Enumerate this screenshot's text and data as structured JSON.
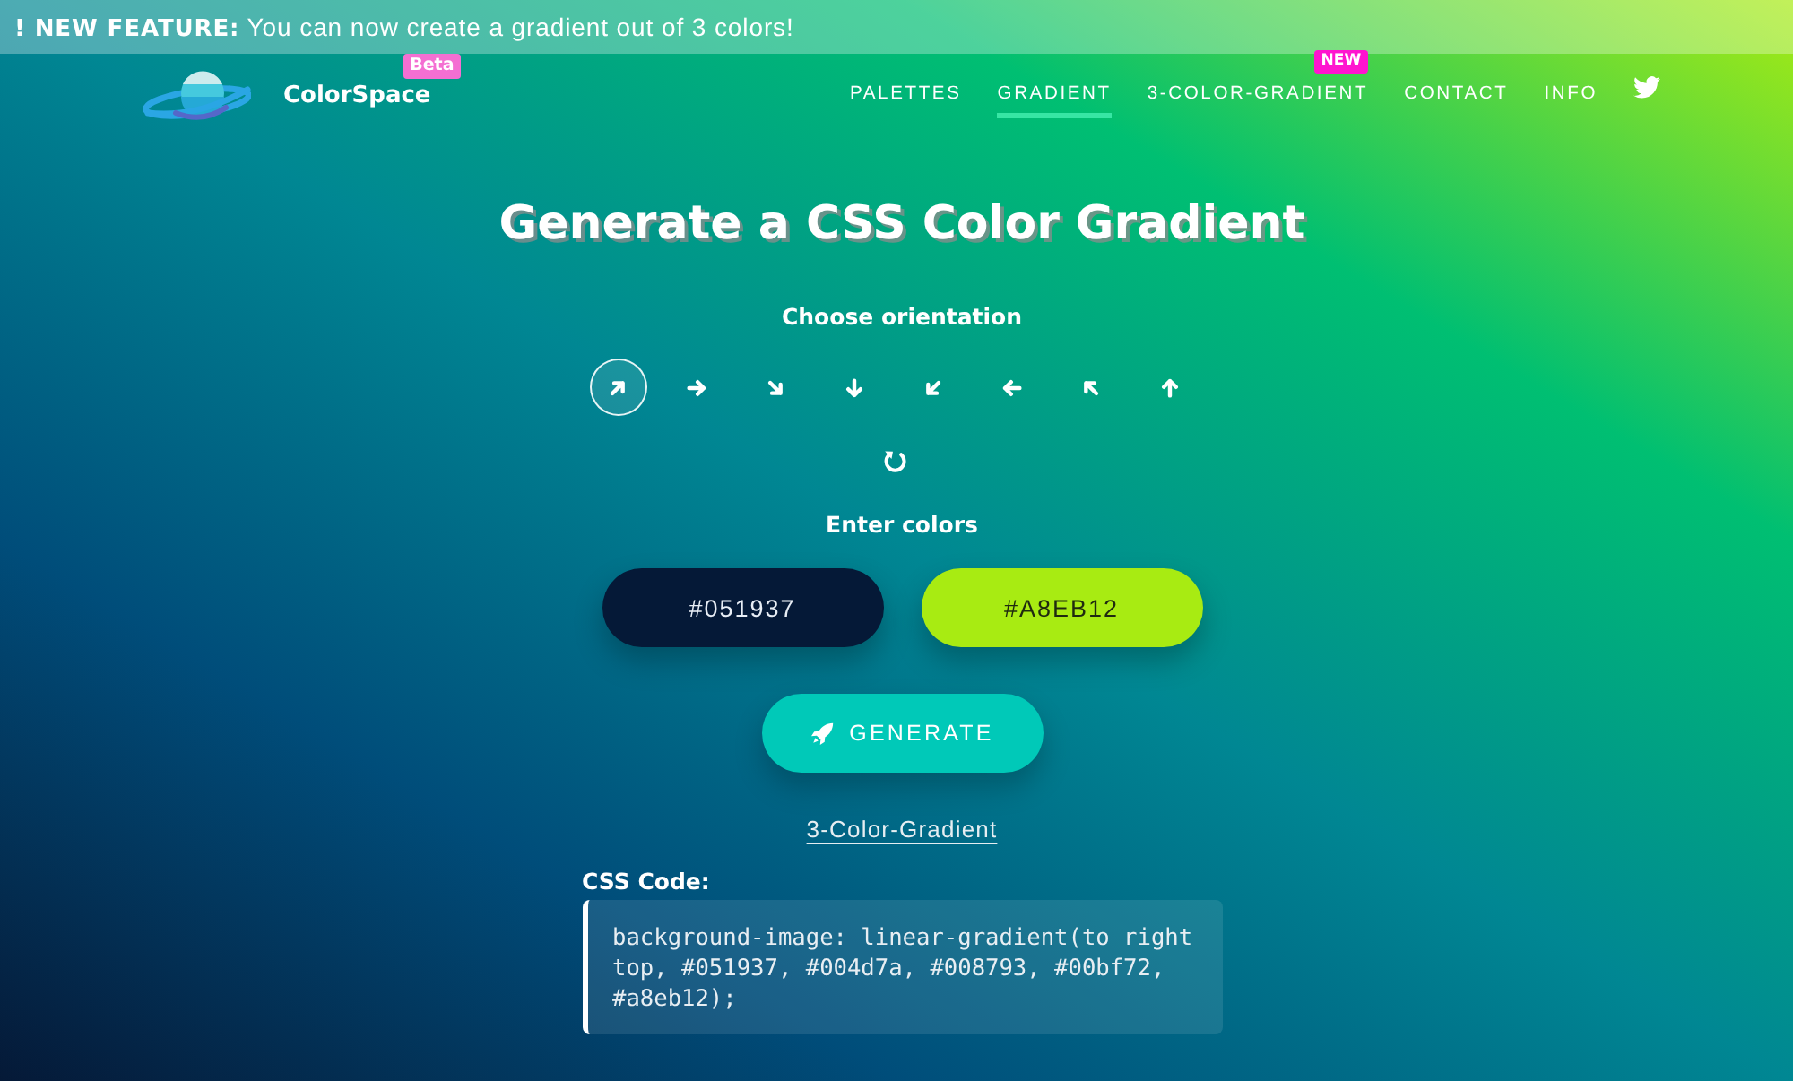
{
  "banner": {
    "text": "**! NEW FEATURE:** You can now create a gradient out of 3 colors!"
  },
  "header": {
    "brand": {
      "name": "ColorSpace",
      "badge": "Beta"
    },
    "nav": [
      {
        "label": "PALETTES",
        "selected": false
      },
      {
        "label": "GRADIENT",
        "selected": true
      },
      {
        "label": "3-COLOR-GRADIENT",
        "selected": false,
        "badge": "NEW"
      },
      {
        "label": "CONTACT",
        "selected": false
      },
      {
        "label": "INFO",
        "selected": false
      }
    ]
  },
  "title": "Generate a CSS Color Gradient",
  "orientation": {
    "label": "Choose orientation",
    "options": [
      {
        "kind": "up-right",
        "selected": true
      },
      {
        "kind": "right",
        "selected": false
      },
      {
        "kind": "down-right",
        "selected": false
      },
      {
        "kind": "down",
        "selected": false
      },
      {
        "kind": "down-left",
        "selected": false
      },
      {
        "kind": "left",
        "selected": false
      },
      {
        "kind": "up-left",
        "selected": false
      },
      {
        "kind": "up",
        "selected": false
      }
    ]
  },
  "colors": {
    "label": "Enter colors",
    "fields": [
      {
        "value": "#051937",
        "color": "#051937"
      },
      {
        "value": "#A8EB12",
        "color": "#a8eb12"
      }
    ]
  },
  "generate_button": "GENERATE",
  "link": "3-Color-Gradient",
  "css_code": {
    "label": "CSS Code:",
    "code": "background-image: linear-gradient(to right top, #051937, #004d7a, #008793, #00bf72, #a8eb12);"
  }
}
